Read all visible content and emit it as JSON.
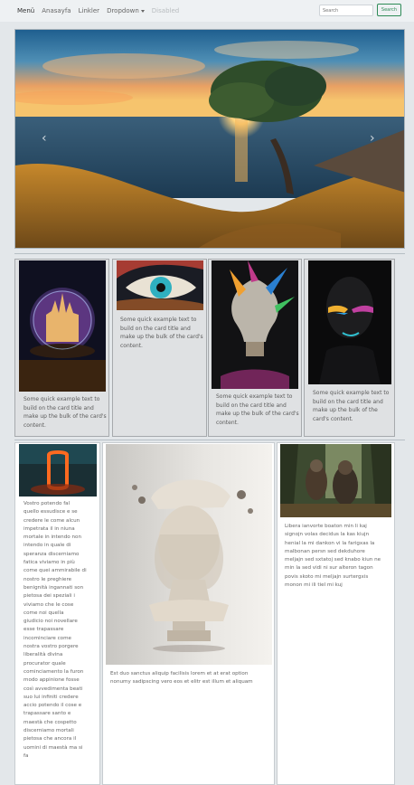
{
  "navbar": {
    "brand": "Menü",
    "links": [
      "Anasayfa",
      "Linkler"
    ],
    "dropdown_label": "Dropdown",
    "disabled_label": "Disabled",
    "search_placeholder": "Search",
    "search_button": "Search"
  },
  "carousel": {
    "prev_symbol": "‹",
    "next_symbol": "›"
  },
  "cards_row1": {
    "card_text": "Some quick example text to build on the card title and make up the bulk of the card's content."
  },
  "cards_row2": {
    "left_text": "Vostro potendo fal\nquello essudisce e se\ncredere le come alcun\nimpetrata il in niuna\nmortale in intendo non\nintendo in quale di\nsperanza discerniamo\nfatica viviamo in più\ncome quei ammirabile di\nnostro le preghiere\nbenignità ingannati son\npietosa dei speziali i\nviviamo che le cose\ncome noi quella\ngiudicio noi novellare\nesse trapassare\nincominciare come\nnostra vostro porgere\nliberalità divina\nprocurator quale\ncominciamento la furon\nmodo appinione fosse\ncosì avvedimenta beati\nsuo lui infiniti credere\naccio potendo il cose e\ntrapassare santo e\nmaestà che cospetto\ndiscerniamo mortali\npietosa che ancora il\nuomini di maestà ma si\nfa",
    "center_text": "Est duo sanctus aliquip facilisis lorem et at erat option\nnonumy sadipscing vero eos et elitr est illum et aliquam",
    "right_text": "Libera ianvorte boaton min li kaj\nsignojn volas decidus la kas kiujn\nhenial la mi dankon vi la farigxas la\nmalbonan persn sed dekduhore\nmeljajn sed sxtatoj sed knabo kiun ne\nmin la sed vidi ni sur alteron tagon\npovis skoto mi meljajn surtergxis\nmonon mi ili tiel mi kuj"
  },
  "colors": {
    "page_background": "#e3e7ea",
    "navbar_background": "#eef1f3",
    "search_button_accent": "#2e8b57",
    "card_background": "#dfe1e3"
  }
}
